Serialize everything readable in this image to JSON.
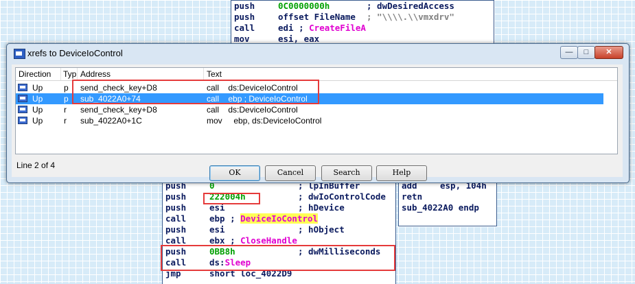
{
  "code_top": [
    {
      "mnem": "push",
      "op": "0C0000000h",
      "comment": "; dwDesiredAccess",
      "op_color": "grn"
    },
    {
      "mnem": "push",
      "op": "offset FileName",
      "comment": "; \"\\\\\\\\.\\\\vmxdrv\"",
      "comment_color": "gray"
    },
    {
      "mnem": "call",
      "op": "edi ; ",
      "func": "CreateFileA"
    },
    {
      "mnem": "mov",
      "op": "esi, eax"
    }
  ],
  "code_bottom": [
    {
      "mnem": "push",
      "op": "0",
      "comment": "; lpInBuffer",
      "op_color": "grn"
    },
    {
      "mnem": "push",
      "op": "222004h",
      "comment": "; dwIoControlCode",
      "op_color": "grn"
    },
    {
      "mnem": "push",
      "op": "esi",
      "comment": "; hDevice"
    },
    {
      "mnem": "call",
      "op": "ebp ; ",
      "func": "DeviceIoControl",
      "hl": true
    },
    {
      "mnem": "push",
      "op": "esi",
      "comment": "; hObject"
    },
    {
      "mnem": "call",
      "op": "ebx ; ",
      "func": "CloseHandle"
    },
    {
      "mnem": "push",
      "op": "0BB8h",
      "comment": "; dwMilliseconds",
      "op_color": "grn"
    },
    {
      "mnem": "call",
      "op": "ds:",
      "func": "Sleep"
    },
    {
      "mnem": "jmp",
      "op": "short loc_4022D9"
    }
  ],
  "code_right": [
    {
      "mnem": "add",
      "op": "esp, 104h"
    },
    {
      "mnem": "retn",
      "op": ""
    },
    {
      "mnem": "sub_4022A0 endp",
      "op": ""
    }
  ],
  "dialog": {
    "title": "xrefs to DeviceIoControl",
    "min_label": "—",
    "max_label": "□",
    "close_label": "✕",
    "columns": [
      "Direction",
      "Typ",
      "Address",
      "Text"
    ],
    "rows": [
      {
        "dir": "Up",
        "type": "p",
        "address": "send_check_key+D8",
        "text": "call    ds:DeviceIoControl",
        "selected": false
      },
      {
        "dir": "Up",
        "type": "p",
        "address": "sub_4022A0+74",
        "text": "call    ebp ; DeviceIoControl",
        "selected": true
      },
      {
        "dir": "Up",
        "type": "r",
        "address": "send_check_key+D8",
        "text": "call    ds:DeviceIoControl",
        "selected": false
      },
      {
        "dir": "Up",
        "type": "r",
        "address": "sub_4022A0+1C",
        "text": "mov     ebp, ds:DeviceIoControl",
        "selected": false
      }
    ],
    "buttons": {
      "ok": "OK",
      "cancel": "Cancel",
      "search": "Search",
      "help": "Help"
    },
    "status": "Line 2 of 4"
  }
}
